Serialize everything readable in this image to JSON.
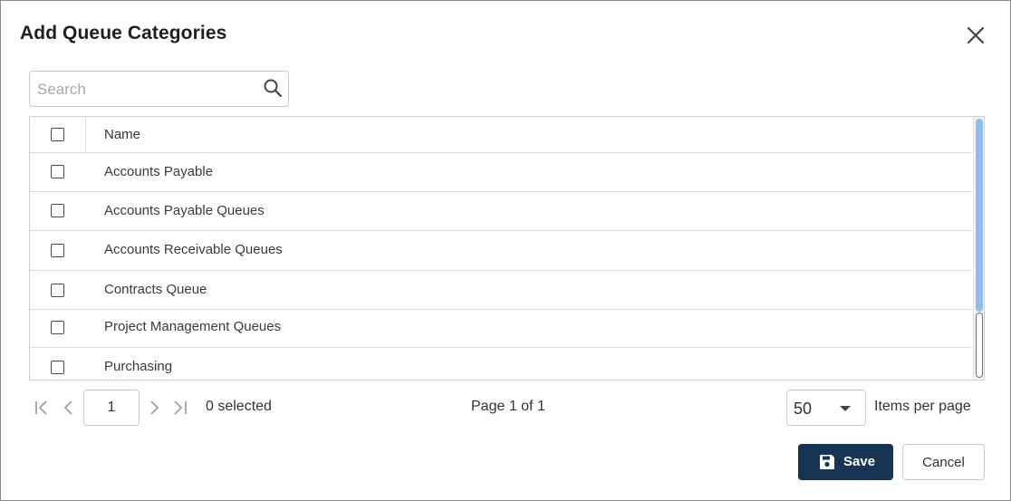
{
  "dialog": {
    "title": "Add Queue Categories",
    "close_icon": "close-icon"
  },
  "search": {
    "placeholder": "Search",
    "value": "",
    "icon": "search-icon"
  },
  "grid": {
    "columns": [
      "Name"
    ],
    "rows": [
      {
        "name": "Accounts Payable",
        "checked": false
      },
      {
        "name": "Accounts Payable Queues",
        "checked": false
      },
      {
        "name": "Accounts Receivable Queues",
        "checked": false
      },
      {
        "name": "Contracts Queue",
        "checked": false
      },
      {
        "name": "Project Management Queues",
        "checked": false
      },
      {
        "name": "Purchasing",
        "checked": false
      }
    ]
  },
  "pager": {
    "current_page": "1",
    "selected_text": "0 selected",
    "page_info": "Page 1 of 1",
    "per_page": "50",
    "per_page_label": "Items per page"
  },
  "actions": {
    "save_label": "Save",
    "cancel_label": "Cancel"
  },
  "colors": {
    "primary": "#173452",
    "scroll_thumb": "#8fbfe6",
    "border": "#c8c8c8"
  }
}
